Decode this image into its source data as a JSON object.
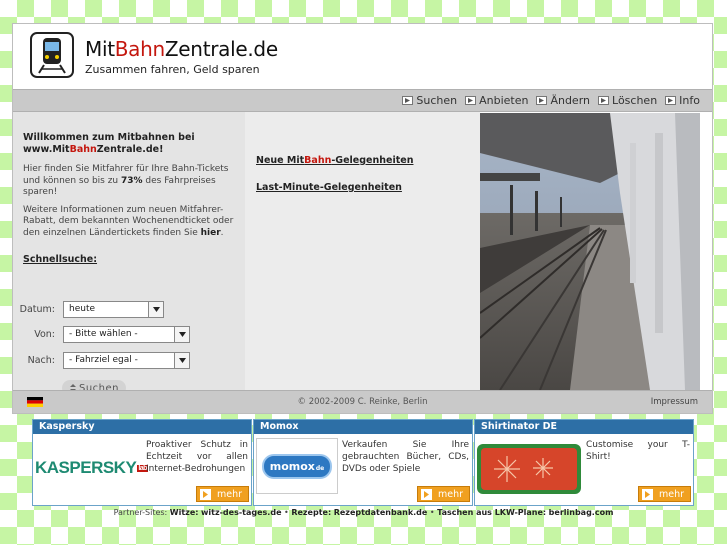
{
  "header": {
    "brand_pre": "Mit",
    "brand_mid": "Bahn",
    "brand_post": "Zentrale.de",
    "slogan": "Zusammen fahren, Geld sparen"
  },
  "nav": {
    "items": [
      {
        "label": "Suchen"
      },
      {
        "label": "Anbieten"
      },
      {
        "label": "Ändern"
      },
      {
        "label": "Löschen"
      },
      {
        "label": "Info"
      }
    ]
  },
  "left": {
    "welcome_line1": "Willkommen zum Mitbahnen bei",
    "welcome_pre": "www.Mit",
    "welcome_mid": "Bahn",
    "welcome_post": "Zentrale.de!",
    "para1_pre": "Hier finden Sie Mitfahrer für Ihre Bahn-Tickets und können so bis zu ",
    "para1_bold": "73%",
    "para1_post": " des Fahrpreises sparen!",
    "para2_pre": "Weitere Informationen zum neuen Mitfahrer-Rabatt, dem bekannten Wochenendticket oder den einzelnen Ländertickets finden Sie ",
    "para2_bold": "hier",
    "para2_post": ".",
    "quick_search": "Schnellsuche:",
    "form": {
      "date_label": "Datum:",
      "date_value": "heute",
      "from_label": "Von:",
      "from_value": "- Bitte wählen -",
      "to_label": "Nach:",
      "to_value": "- Fahrziel egal -",
      "search_button": "Suchen"
    }
  },
  "middle": {
    "link1_pre": "Neue Mit",
    "link1_mid": "Bahn",
    "link1_post": "-Gelegenheiten",
    "link2": "Last-Minute-Gelegenheiten"
  },
  "footer": {
    "copyright": "© 2002-2009 C. Reinke, Berlin",
    "impressum": "Impressum"
  },
  "ads": [
    {
      "title": "Kaspersky",
      "logo_text": "KASPERSKY",
      "logo_suffix": "lab",
      "text": "Proaktiver Schutz in Echtzeit vor allen Internet-Bedrohungen",
      "more": "mehr"
    },
    {
      "title": "Momox",
      "logo_text": "momox",
      "logo_suffix": "de",
      "text": "Verkaufen Sie Ihre gebrauchten Bücher, CDs, DVDs oder Spiele",
      "more": "mehr"
    },
    {
      "title": "Shirtinator DE",
      "text": "Customise your T-Shirt!",
      "more": "mehr"
    }
  ],
  "partners": {
    "label": "Partner-Sites:",
    "item1_label": "Witze:",
    "item1_site": "witz-des-tages.de",
    "item2_label": "Rezepte:",
    "item2_site": "Rezeptdatenbank.de",
    "item3_label": "Taschen aus LKW-Plane:",
    "item3_site": "berlinbag.com",
    "separator": "•"
  },
  "colors": {
    "brand_red": "#c4170e",
    "ad_header_blue": "#2d6fa6",
    "more_button_orange": "#f0a020",
    "checker_green": "#c6f5a4"
  }
}
